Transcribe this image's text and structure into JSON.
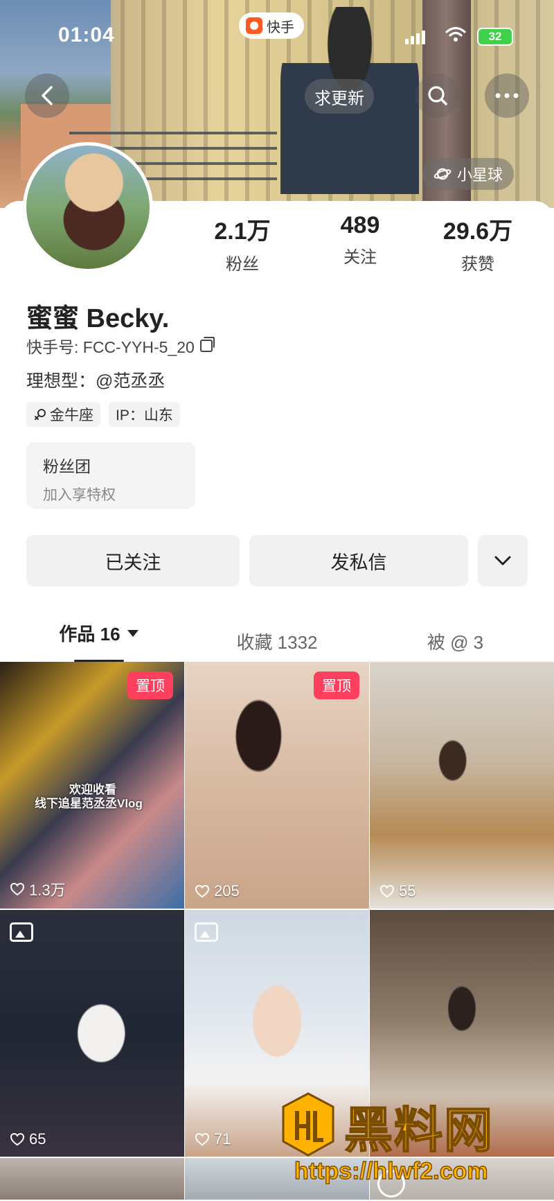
{
  "status_bar": {
    "time": "01:04",
    "battery": "32",
    "app_name": "快手"
  },
  "header": {
    "update_button": "求更新",
    "planet_button": "小星球"
  },
  "profile": {
    "stats": [
      {
        "value": "2.1万",
        "label": "粉丝"
      },
      {
        "value": "489",
        "label": "关注"
      },
      {
        "value": "29.6万",
        "label": "获赞"
      }
    ],
    "nickname": "蜜蜜 Becky.",
    "kuaishou_id": "快手号: FCC-YYH-5_20",
    "bio": "理想型：@范丞丞",
    "tags": [
      "金牛座",
      "IP：山东"
    ],
    "fan_club": {
      "title": "粉丝团",
      "subtitle": "加入享特权"
    }
  },
  "actions": {
    "follow": "已关注",
    "message": "发私信"
  },
  "tabs": {
    "works": "作品 16",
    "favorites": "收藏 1332",
    "mentioned": "被 @ 3"
  },
  "grid": {
    "pin_label": "置顶",
    "overlay_text": [
      "欢迎收看",
      "线下追星范丞丞Vlog"
    ],
    "likes": [
      "1.3万",
      "205",
      "55",
      "65",
      "71"
    ]
  },
  "watermark": {
    "title": "黑料网",
    "url": "https://hlwf2.com"
  },
  "colors": {
    "pin": "#ff3f5d",
    "battery": "#3fd14a",
    "watermark": "#ffb300"
  },
  "icons": [
    "back-icon",
    "search-icon",
    "more-icon",
    "planet-icon",
    "copy-icon",
    "gender-female-icon",
    "chevron-down-icon",
    "heart-icon",
    "image-icon",
    "wifi-icon",
    "signal-icon"
  ]
}
